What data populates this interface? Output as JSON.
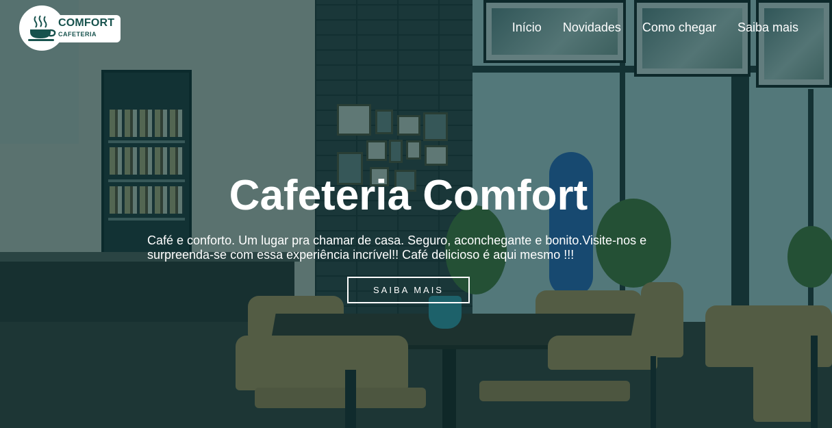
{
  "brand": {
    "name": "COMFORT",
    "subtitle": "CAFETERIA",
    "icon": "coffee-cup-icon",
    "color": "#17524d"
  },
  "nav": {
    "items": [
      {
        "label": "Início"
      },
      {
        "label": "Novidades"
      },
      {
        "label": "Como chegar"
      },
      {
        "label": "Saiba mais"
      }
    ]
  },
  "hero": {
    "title": "Cafeteria Comfort",
    "description": "Café e conforto. Um lugar pra chamar de casa. Seguro, aconchegante e bonito.Visite-nos e surpreenda-se com essa experiência incrível!! Café delicioso é aqui mesmo !!!",
    "button_label": "SAIBA MAIS",
    "overlay_color": "#0c373a"
  }
}
